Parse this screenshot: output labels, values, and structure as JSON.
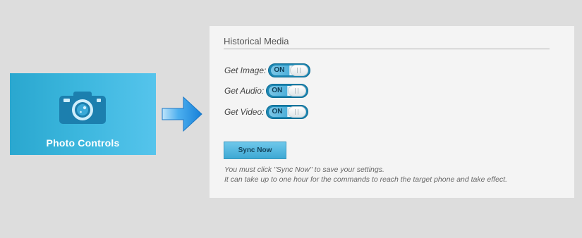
{
  "tile": {
    "label": "Photo Controls",
    "icon": "camera-icon"
  },
  "arrow": {
    "icon": "arrow-right-icon"
  },
  "panel": {
    "title": "Historical Media",
    "settings": [
      {
        "label": "Get Image:",
        "state": "ON"
      },
      {
        "label": "Get Audio:",
        "state": "ON"
      },
      {
        "label": "Get Video:",
        "state": "ON"
      }
    ],
    "sync_button": "Sync Now",
    "note_line1": "You must click \"Sync Now\" to save your settings.",
    "note_line2": "It can take up to one hour for the commands to reach the target phone and take effect."
  },
  "colors": {
    "tile_start": "#2aa7cf",
    "tile_end": "#55c4ec",
    "toggle_on": "#1d87b3",
    "arrow": "#1e8fe0"
  }
}
